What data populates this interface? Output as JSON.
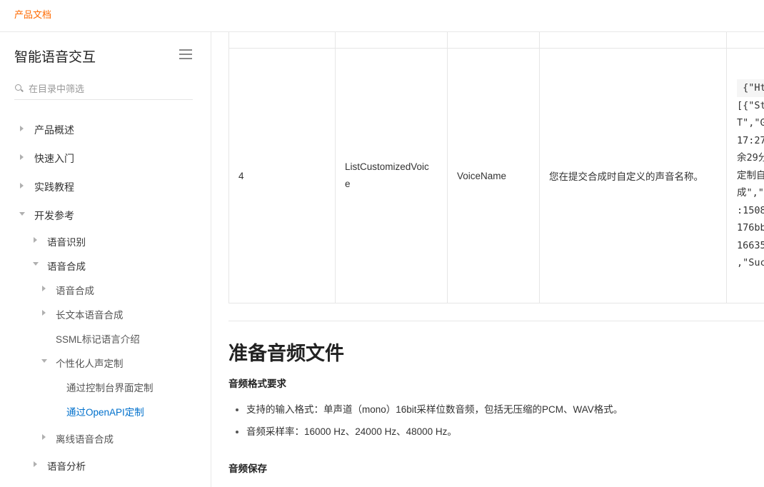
{
  "header": {
    "brand": "产品文档"
  },
  "sidebar": {
    "title": "智能语音交互",
    "filter_placeholder": "在目录中筛选",
    "items": [
      {
        "label": "产品概述"
      },
      {
        "label": "快速入门"
      },
      {
        "label": "实践教程"
      },
      {
        "label": "开发参考"
      },
      {
        "label": "语音识别"
      },
      {
        "label": "语音合成"
      },
      {
        "label": "语音合成"
      },
      {
        "label": "长文本语音合成"
      },
      {
        "label": "SSML标记语言介绍"
      },
      {
        "label": "个性化人声定制"
      },
      {
        "label": "通过控制台界面定制"
      },
      {
        "label": "通过OpenAPI定制"
      },
      {
        "label": "离线语音合成"
      },
      {
        "label": "语音分析"
      }
    ]
  },
  "table": {
    "row": {
      "index": "4",
      "api_line1": "ListCustomizedVoic",
      "api_line2": "e",
      "param": "VoiceName",
      "desc": "您在提交合成时自定义的声音名称。",
      "code_lines": [
        " {\"Ht",
        "[{\"St",
        "T\",\"G",
        "17:27",
        "余29分",
        "定制自",
        "成\",\"",
        ":1508",
        "176bb",
        "16635",
        ",\"Suc"
      ]
    }
  },
  "main": {
    "section_title": "准备音频文件",
    "format_heading": "音频格式要求",
    "bullets": [
      "支持的输入格式：单声道（mono）16bit采样位数音频，包括无压缩的PCM、WAV格式。",
      "音频采样率：16000 Hz、24000 Hz、48000 Hz。"
    ],
    "save_heading": "音频保存"
  }
}
